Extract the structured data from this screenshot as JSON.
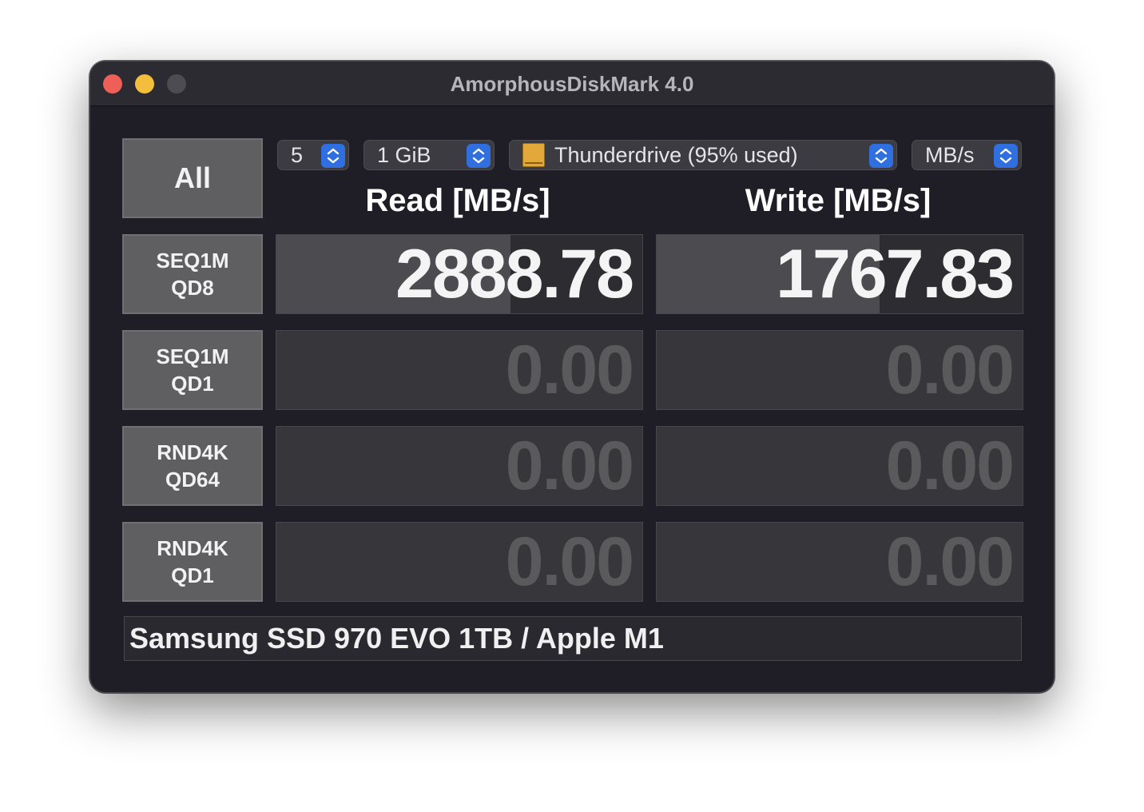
{
  "window": {
    "title": "AmorphousDiskMark 4.0"
  },
  "controls": {
    "count": "5",
    "size": "1 GiB",
    "drive": "Thunderdrive (95% used)",
    "unit": "MB/s"
  },
  "headers": {
    "read": "Read [MB/s]",
    "write": "Write [MB/s]"
  },
  "buttons": {
    "all": "All"
  },
  "tests": [
    {
      "line1": "SEQ1M",
      "line2": "QD8",
      "read": "2888.78",
      "write": "1767.83",
      "read_fill": 0.64,
      "write_fill": 0.61
    },
    {
      "line1": "SEQ1M",
      "line2": "QD1",
      "read": "0.00",
      "write": "0.00",
      "read_fill": 0,
      "write_fill": 0
    },
    {
      "line1": "RND4K",
      "line2": "QD64",
      "read": "0.00",
      "write": "0.00",
      "read_fill": 0,
      "write_fill": 0
    },
    {
      "line1": "RND4K",
      "line2": "QD1",
      "read": "0.00",
      "write": "0.00",
      "read_fill": 0,
      "write_fill": 0
    }
  ],
  "footer": {
    "comment": "Samsung SSD 970 EVO 1TB / Apple M1"
  },
  "colors": {
    "close": "#ed5f57",
    "minimize": "#f3be3b",
    "accent": "#2f6fe0"
  }
}
